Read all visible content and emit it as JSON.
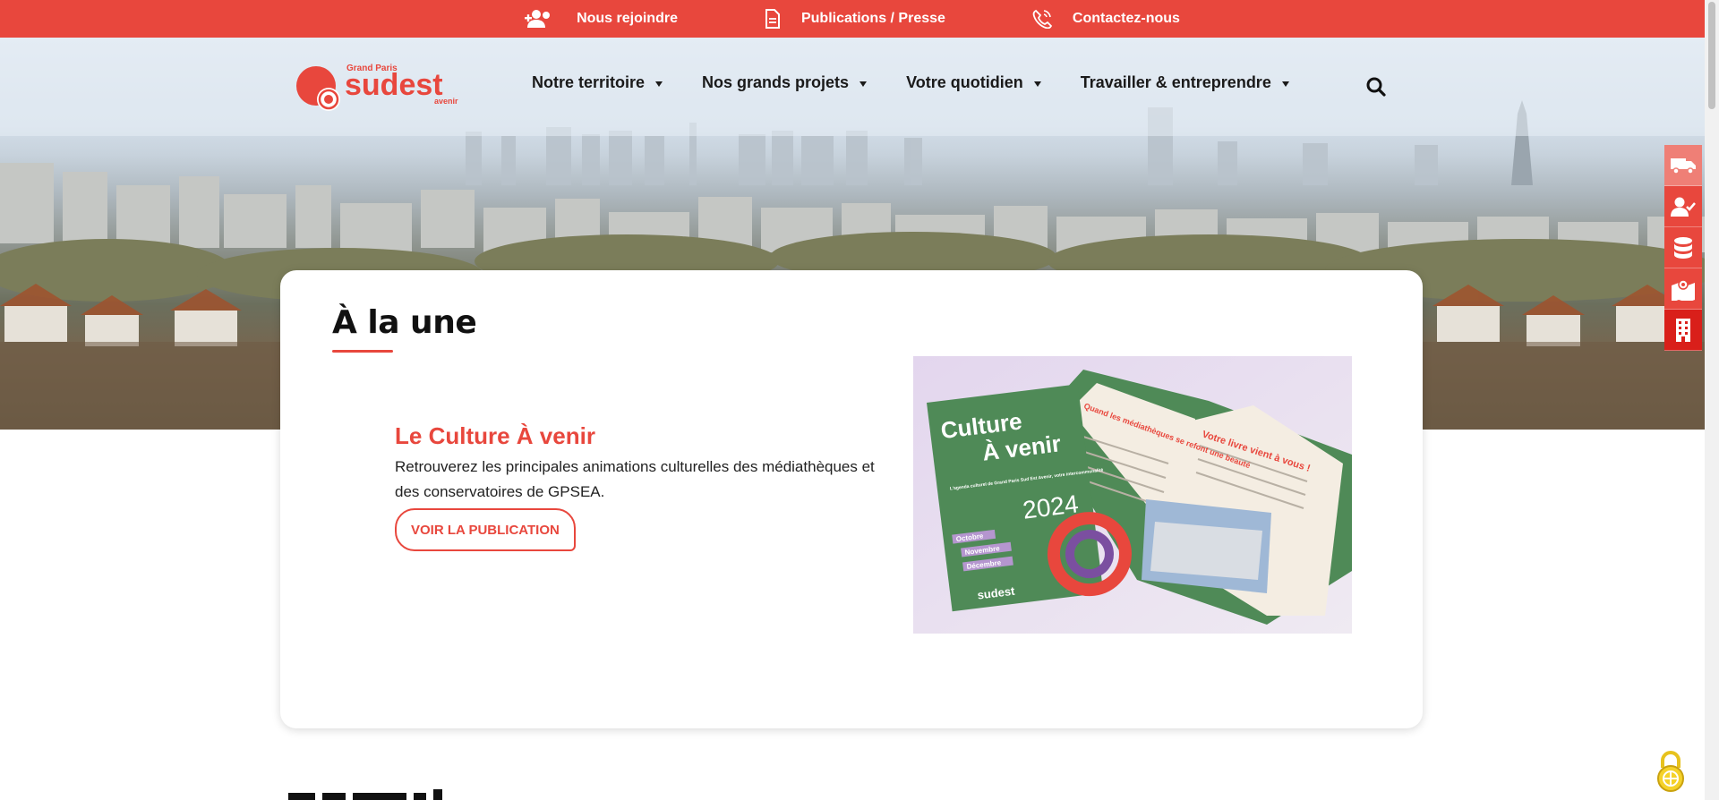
{
  "topbar": {
    "items": [
      {
        "icon": "user-plus-icon",
        "label": "Nous rejoindre"
      },
      {
        "icon": "document-icon",
        "label": "Publications / Presse"
      },
      {
        "icon": "phone-icon",
        "label": "Contactez-nous"
      }
    ]
  },
  "logo": {
    "top": "Grand Paris",
    "main": "sudest",
    "bottom": "avenir"
  },
  "nav": {
    "items": [
      {
        "label": "Notre territoire"
      },
      {
        "label": "Nos grands projets"
      },
      {
        "label": "Votre quotidien"
      },
      {
        "label": "Travailler & entreprendre"
      }
    ]
  },
  "side_tools": [
    "truck-icon",
    "user-check-icon",
    "database-icon",
    "map-icon",
    "building-icon"
  ],
  "headline": {
    "section_title": "À la une",
    "publication": {
      "title": "Le Culture À venir",
      "description": "Retrouverez les principales animations culturelles des médiathèques et des conservatoires de GPSEA.",
      "button_label": "VOIR LA PUBLICATION",
      "cover": {
        "title_line1": "Culture",
        "title_line2": "À venir",
        "subtitle": "L'agenda culturel de Grand Paris Sud Est Avenir, votre intercommunalité",
        "year": "2024",
        "months": [
          "Octobre",
          "Novembre",
          "Décembre"
        ],
        "brand": "sudest",
        "inner_headline1": "Quand les médiathèques se refont une beauté",
        "inner_headline2": "Votre livre vient à vous !"
      }
    }
  },
  "colors": {
    "brand_red": "#e8473d",
    "cover_green": "#4f8a57",
    "accent_lilac": "#e6daf0"
  }
}
